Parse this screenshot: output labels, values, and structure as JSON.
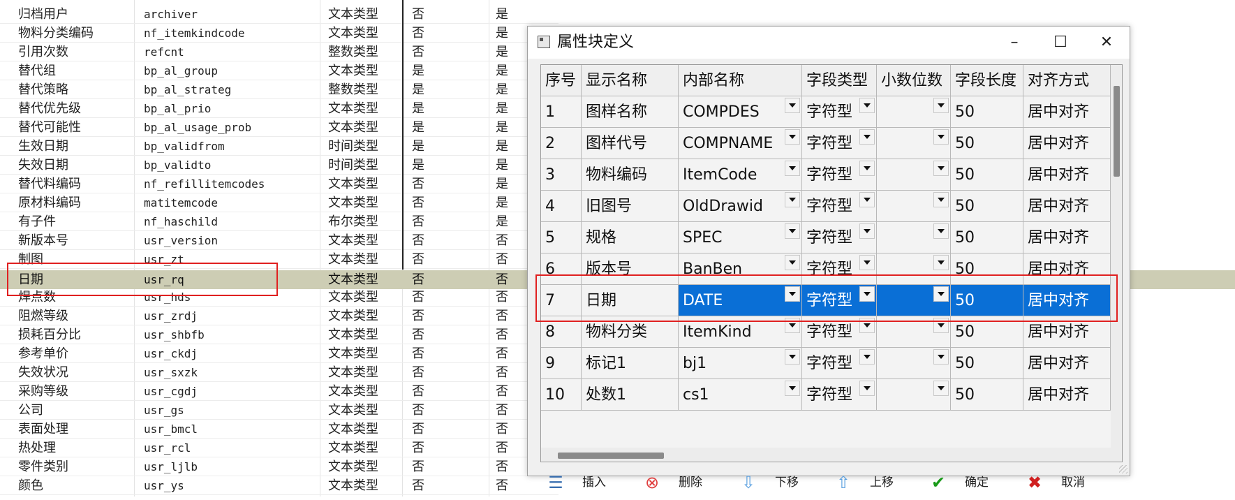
{
  "background_table": {
    "rows": [
      [
        "归档用户",
        "archiver",
        "文本类型",
        "否",
        "是"
      ],
      [
        "物料分类编码",
        "nf_itemkindcode",
        "文本类型",
        "否",
        "是"
      ],
      [
        "引用次数",
        "refcnt",
        "整数类型",
        "否",
        "是"
      ],
      [
        "替代组",
        "bp_al_group",
        "文本类型",
        "是",
        "是"
      ],
      [
        "替代策略",
        "bp_al_strateg",
        "整数类型",
        "是",
        "是"
      ],
      [
        "替代优先级",
        "bp_al_prio",
        "文本类型",
        "是",
        "是"
      ],
      [
        "替代可能性",
        "bp_al_usage_prob",
        "文本类型",
        "是",
        "是"
      ],
      [
        "生效日期",
        "bp_validfrom",
        "时间类型",
        "是",
        "是"
      ],
      [
        "失效日期",
        "bp_validto",
        "时间类型",
        "是",
        "是"
      ],
      [
        "替代料编码",
        "nf_refillitemcodes",
        "文本类型",
        "否",
        "是"
      ],
      [
        "原材料编码",
        "matitemcode",
        "文本类型",
        "否",
        "是"
      ],
      [
        "有子件",
        "nf_haschild",
        "布尔类型",
        "否",
        "是"
      ],
      [
        "新版本号",
        "usr_version",
        "文本类型",
        "否",
        "否"
      ],
      [
        "制图",
        "usr_zt",
        "文本类型",
        "否",
        "否"
      ],
      [
        "日期",
        "usr_rq",
        "文本类型",
        "否",
        "否"
      ],
      [
        "焊点数",
        "usr_hds",
        "文本类型",
        "否",
        "否"
      ],
      [
        "阻燃等级",
        "usr_zrdj",
        "文本类型",
        "否",
        "否"
      ],
      [
        "损耗百分比",
        "usr_shbfb",
        "文本类型",
        "否",
        "否"
      ],
      [
        "参考单价",
        "usr_ckdj",
        "文本类型",
        "否",
        "否"
      ],
      [
        "失效状况",
        "usr_sxzk",
        "文本类型",
        "否",
        "否"
      ],
      [
        "采购等级",
        "usr_cgdj",
        "文本类型",
        "否",
        "否"
      ],
      [
        "公司",
        "usr_gs",
        "文本类型",
        "否",
        "否"
      ],
      [
        "表面处理",
        "usr_bmcl",
        "文本类型",
        "否",
        "否"
      ],
      [
        "热处理",
        "usr_rcl",
        "文本类型",
        "否",
        "否"
      ],
      [
        "零件类别",
        "usr_ljlb",
        "文本类型",
        "否",
        "否"
      ],
      [
        "颜色",
        "usr_ys",
        "文本类型",
        "否",
        "否"
      ]
    ],
    "highlighted_index": 14
  },
  "dialog": {
    "title": "属性块定义",
    "window_buttons": {
      "minimize": "–",
      "maximize": "☐",
      "close": "✕"
    },
    "columns": [
      "序号",
      "显示名称",
      "内部名称",
      "字段类型",
      "小数位数",
      "字段长度",
      "对齐方式"
    ],
    "rows": [
      {
        "no": "1",
        "display": "图样名称",
        "internal": "COMPDES",
        "type": "字符型",
        "decimals": "",
        "length": "50",
        "align": "居中对齐"
      },
      {
        "no": "2",
        "display": "图样代号",
        "internal": "COMPNAME",
        "type": "字符型",
        "decimals": "",
        "length": "50",
        "align": "居中对齐"
      },
      {
        "no": "3",
        "display": "物料编码",
        "internal": "ItemCode",
        "type": "字符型",
        "decimals": "",
        "length": "50",
        "align": "居中对齐"
      },
      {
        "no": "4",
        "display": "旧图号",
        "internal": "OldDrawid",
        "type": "字符型",
        "decimals": "",
        "length": "50",
        "align": "居中对齐"
      },
      {
        "no": "5",
        "display": "规格",
        "internal": "SPEC",
        "type": "字符型",
        "decimals": "",
        "length": "50",
        "align": "居中对齐"
      },
      {
        "no": "6",
        "display": "版本号",
        "internal": "BanBen",
        "type": "字符型",
        "decimals": "",
        "length": "50",
        "align": "居中对齐"
      },
      {
        "no": "7",
        "display": "日期",
        "internal": "DATE",
        "type": "字符型",
        "decimals": "",
        "length": "50",
        "align": "居中对齐"
      },
      {
        "no": "8",
        "display": "物料分类",
        "internal": "ItemKind",
        "type": "字符型",
        "decimals": "",
        "length": "50",
        "align": "居中对齐"
      },
      {
        "no": "9",
        "display": "标记1",
        "internal": "bj1",
        "type": "字符型",
        "decimals": "",
        "length": "50",
        "align": "居中对齐"
      },
      {
        "no": "10",
        "display": "处数1",
        "internal": "cs1",
        "type": "字符型",
        "decimals": "",
        "length": "50",
        "align": "居中对齐"
      }
    ],
    "selected_row_index": 6,
    "toolbar": [
      {
        "name": "insert",
        "label": "插入",
        "icon": "insert-row-icon",
        "color": "#3a6fb0"
      },
      {
        "name": "delete",
        "label": "删除",
        "icon": "delete-icon",
        "color": "#e04040"
      },
      {
        "name": "move-down",
        "label": "下移",
        "icon": "arrow-down-icon",
        "color": "#5aa0e0"
      },
      {
        "name": "move-up",
        "label": "上移",
        "icon": "arrow-up-icon",
        "color": "#5aa0e0"
      },
      {
        "name": "ok",
        "label": "确定",
        "icon": "checkmark-icon",
        "color": "#1a9a1a"
      },
      {
        "name": "cancel",
        "label": "取消",
        "icon": "cross-icon",
        "color": "#d02020"
      }
    ]
  }
}
